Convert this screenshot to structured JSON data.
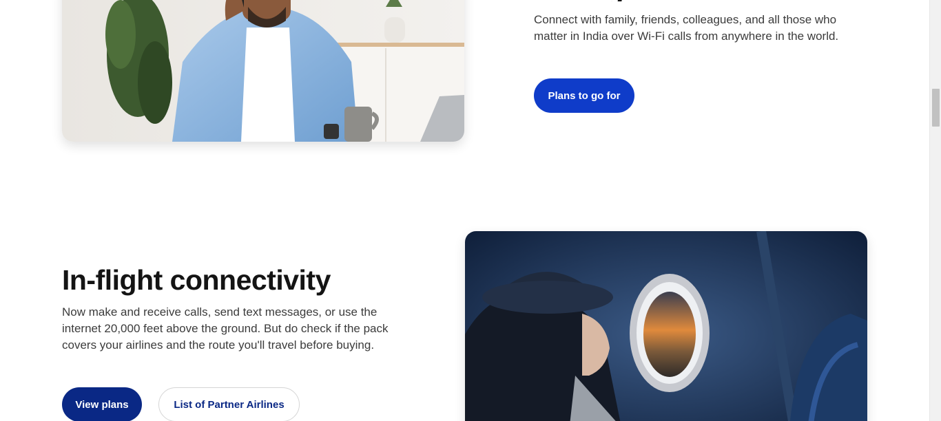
{
  "section_calls": {
    "heading_visible_fragment": "g",
    "description": "Connect with family, friends, colleagues, and all those who matter in India over Wi-Fi calls from anywhere in the world.",
    "cta_label": "Plans to go for",
    "image_subject": "man-on-phone-at-desk",
    "accent_color": "#0f3cc9"
  },
  "section_inflight": {
    "title": "In-flight connectivity",
    "description": "Now make and receive calls, send text messages, or use the internet 20,000 feet above the ground. But do check if the pack covers your airlines and the route you'll travel before buying.",
    "primary_cta_label": "View plans",
    "secondary_cta_label": "List of Partner Airlines",
    "image_subject": "woman-looking-out-airplane-window",
    "accent_color": "#0a2885"
  }
}
